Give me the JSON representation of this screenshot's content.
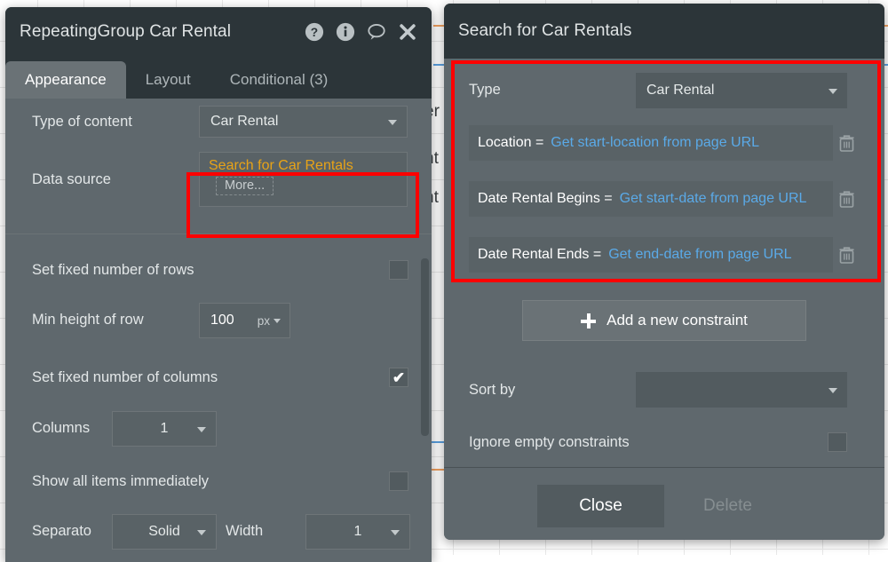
{
  "background": {
    "text_fragments": [
      "er",
      "nt",
      "nt"
    ]
  },
  "left_panel": {
    "title": "RepeatingGroup Car Rental",
    "header_icons": [
      {
        "name": "help-icon",
        "glyph": "?"
      },
      {
        "name": "info-icon",
        "glyph": "i"
      },
      {
        "name": "comment-icon",
        "glyph": "speech-bubble"
      },
      {
        "name": "close-icon",
        "glyph": "x"
      }
    ],
    "tabs": [
      {
        "label": "Appearance",
        "active": true
      },
      {
        "label": "Layout",
        "active": false
      },
      {
        "label": "Conditional (3)",
        "active": false
      }
    ],
    "fields": {
      "type_of_content": {
        "label": "Type of content",
        "value": "Car Rental"
      },
      "data_source": {
        "label": "Data source",
        "value": "Search for Car Rentals",
        "more_label": "More..."
      },
      "set_fixed_rows": {
        "label": "Set fixed number of rows",
        "checked": false
      },
      "min_height_of_row": {
        "label": "Min height of row",
        "value": "100",
        "unit": "px"
      },
      "set_fixed_columns": {
        "label": "Set fixed number of columns",
        "checked": true
      },
      "columns": {
        "label": "Columns",
        "value": "1"
      },
      "show_all_items": {
        "label": "Show all items immediately",
        "checked": false
      },
      "separator": {
        "label": "Separato",
        "style_value": "Solid",
        "width_label": "Width",
        "width_value": "1"
      }
    }
  },
  "right_panel": {
    "title": "Search for Car Rentals",
    "type_row": {
      "label": "Type",
      "value": "Car Rental"
    },
    "constraints": [
      {
        "key": "Location =",
        "value": "Get start-location from page URL"
      },
      {
        "key": "Date Rental Begins =",
        "value": "Get start-date from page URL"
      },
      {
        "key": "Date Rental Ends =",
        "value": "Get end-date from page URL"
      }
    ],
    "add_constraint_label": "Add a new constraint",
    "sort_by": {
      "label": "Sort by",
      "value": ""
    },
    "ignore_empty": {
      "label": "Ignore empty constraints",
      "checked": false
    },
    "buttons": {
      "close": "Close",
      "delete": "Delete"
    }
  },
  "colors": {
    "panel_body": "#5f686d",
    "panel_header": "#2c3539",
    "field_bg": "#596266",
    "accent_orange": "#e8a317",
    "accent_blue": "#5aaae8",
    "highlight_red": "#fe0000",
    "guide_orange": "#f0a060",
    "guide_blue": "#5aa0e0"
  }
}
